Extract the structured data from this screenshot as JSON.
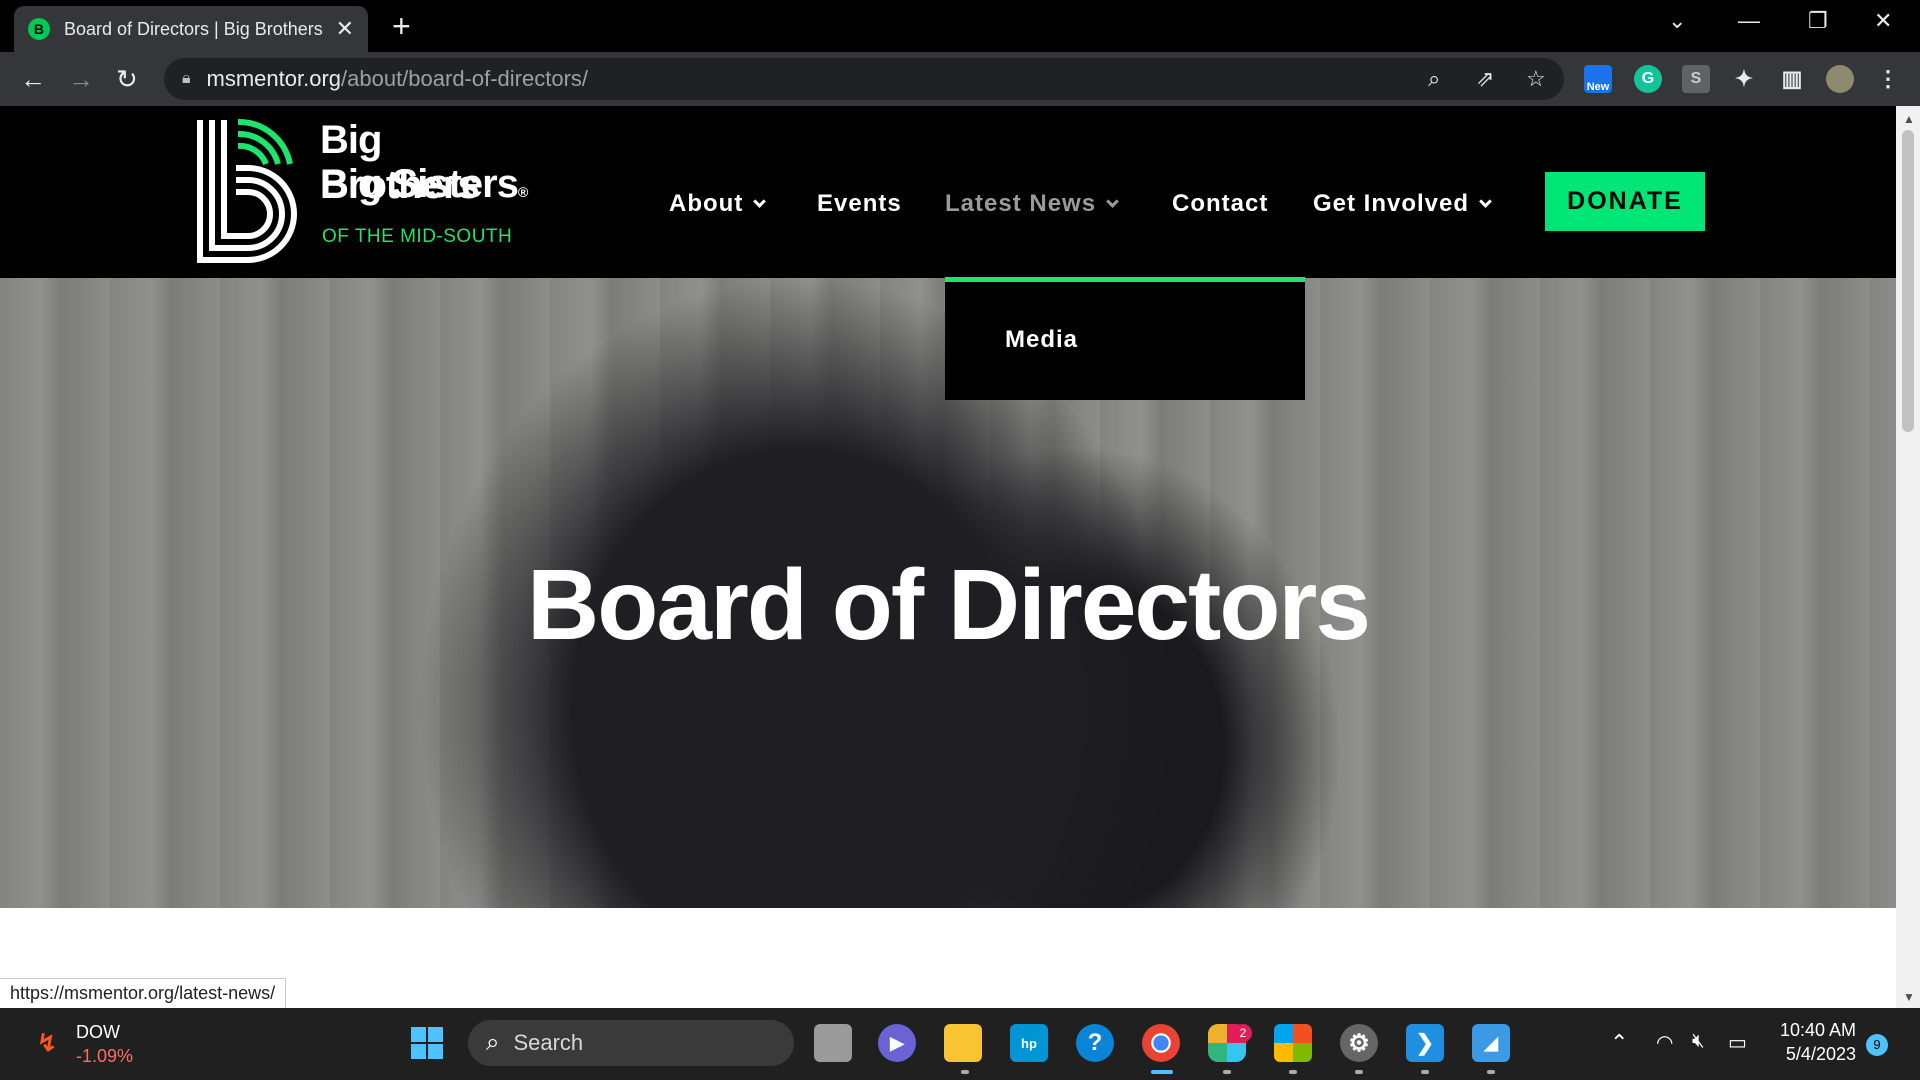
{
  "browser": {
    "tab": {
      "title": "Board of Directors | Big Brothers",
      "favicon": "B"
    },
    "url_host": "msmentor.org",
    "url_path": "/about/board-of-directors/",
    "extension_badge": "New",
    "status_url": "https://msmentor.org/latest-news/"
  },
  "site": {
    "logo": {
      "line1": "Big Brothers",
      "line2": "Big Sisters",
      "registered": "®",
      "subtitle": "OF THE MID-SOUTH"
    },
    "nav": {
      "about": "About",
      "events": "Events",
      "latest_news": "Latest News",
      "contact": "Contact",
      "get_involved": "Get Involved",
      "donate": "DONATE"
    },
    "dropdown": {
      "item": "Media"
    },
    "hero_title": "Board of Directors",
    "accent_color": "#1ee36c"
  },
  "taskbar": {
    "stock_name": "DOW",
    "stock_change": "-1.09%",
    "search_label": "Search",
    "slack_badge": "2",
    "time": "10:40 AM",
    "date": "5/4/2023",
    "notification_count": "9"
  }
}
